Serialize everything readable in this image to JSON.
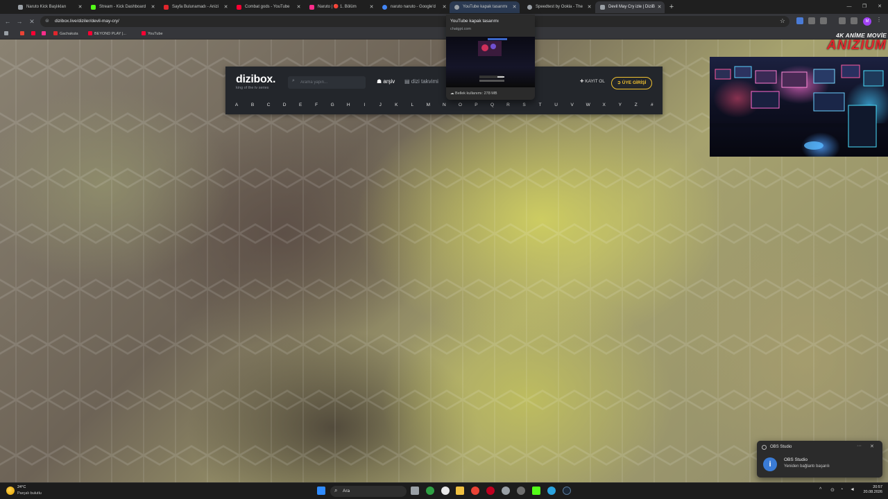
{
  "browser": {
    "tabs": [
      {
        "label": "Naruto Kick Başlıkları",
        "color": "#9aa0a6"
      },
      {
        "label": "Stream - Kick Dashboard",
        "color": "#53fc18"
      },
      {
        "label": "Sayfa Bulunamadı - Anizi",
        "color": "#e0262c"
      },
      {
        "label": "Combat gods - YouTube",
        "color": "#ff0033"
      },
      {
        "label": "Naruto | 🔴 1. Bölüm",
        "color": "#ff2d8b"
      },
      {
        "label": "naruto naruto - Google'd",
        "color": "#4285f4"
      },
      {
        "label": "YouTube kapak tasarımı",
        "color": "#9aa0a6"
      },
      {
        "label": "Speedtest by Ookla - The",
        "color": "#9aa0a6"
      },
      {
        "label": "Devil May Cry izle | DiziB",
        "color": "#9aa0a6"
      }
    ],
    "new_tab": "+",
    "url": "dizibox.live/diziler/devil-may-cry/",
    "bookmarks": [
      {
        "label": "",
        "color": "#ea4335"
      },
      {
        "label": "",
        "color": "#ff0033"
      },
      {
        "label": "",
        "color": "#ff2d8b"
      },
      {
        "label": "Gachakuta",
        "color": "#e0262c"
      },
      {
        "label": "BEYOND PLAY |...",
        "color": "#ff0033"
      },
      {
        "label": "YouTube",
        "color": "#ff0033"
      }
    ],
    "profile_initial": "M"
  },
  "preview": {
    "title": "YouTube kapak tasarımı",
    "domain": "chatgpt.com",
    "memory": "Bellek kullanımı: 278 MB"
  },
  "site": {
    "logo": "dizibox.",
    "tagline": "king of the tv series",
    "search_placeholder": "Arama yapın...",
    "nav_archive": "arşiv",
    "nav_calendar": "dizi takvimi",
    "register": "KAYIT OL",
    "login": "ÜYE GİRİŞİ",
    "alphabet": [
      "A",
      "B",
      "C",
      "D",
      "E",
      "F",
      "G",
      "H",
      "I",
      "J",
      "K",
      "L",
      "M",
      "N",
      "O",
      "P",
      "Q",
      "R",
      "S",
      "T",
      "U",
      "V",
      "W",
      "X",
      "Y",
      "Z",
      "#"
    ]
  },
  "overlay": {
    "brand_line1": "4K ANİME MOVİE",
    "brand_line2": "ANIZIUM"
  },
  "toast": {
    "app": "OBS Studio",
    "title": "OBS Studio",
    "body": "Yeniden bağlantı başarılı"
  },
  "taskbar": {
    "temp": "24°C",
    "weather": "Parçalı bulutlu",
    "search_label": "Ara",
    "time": "20:57",
    "date": "20.08.2026"
  }
}
